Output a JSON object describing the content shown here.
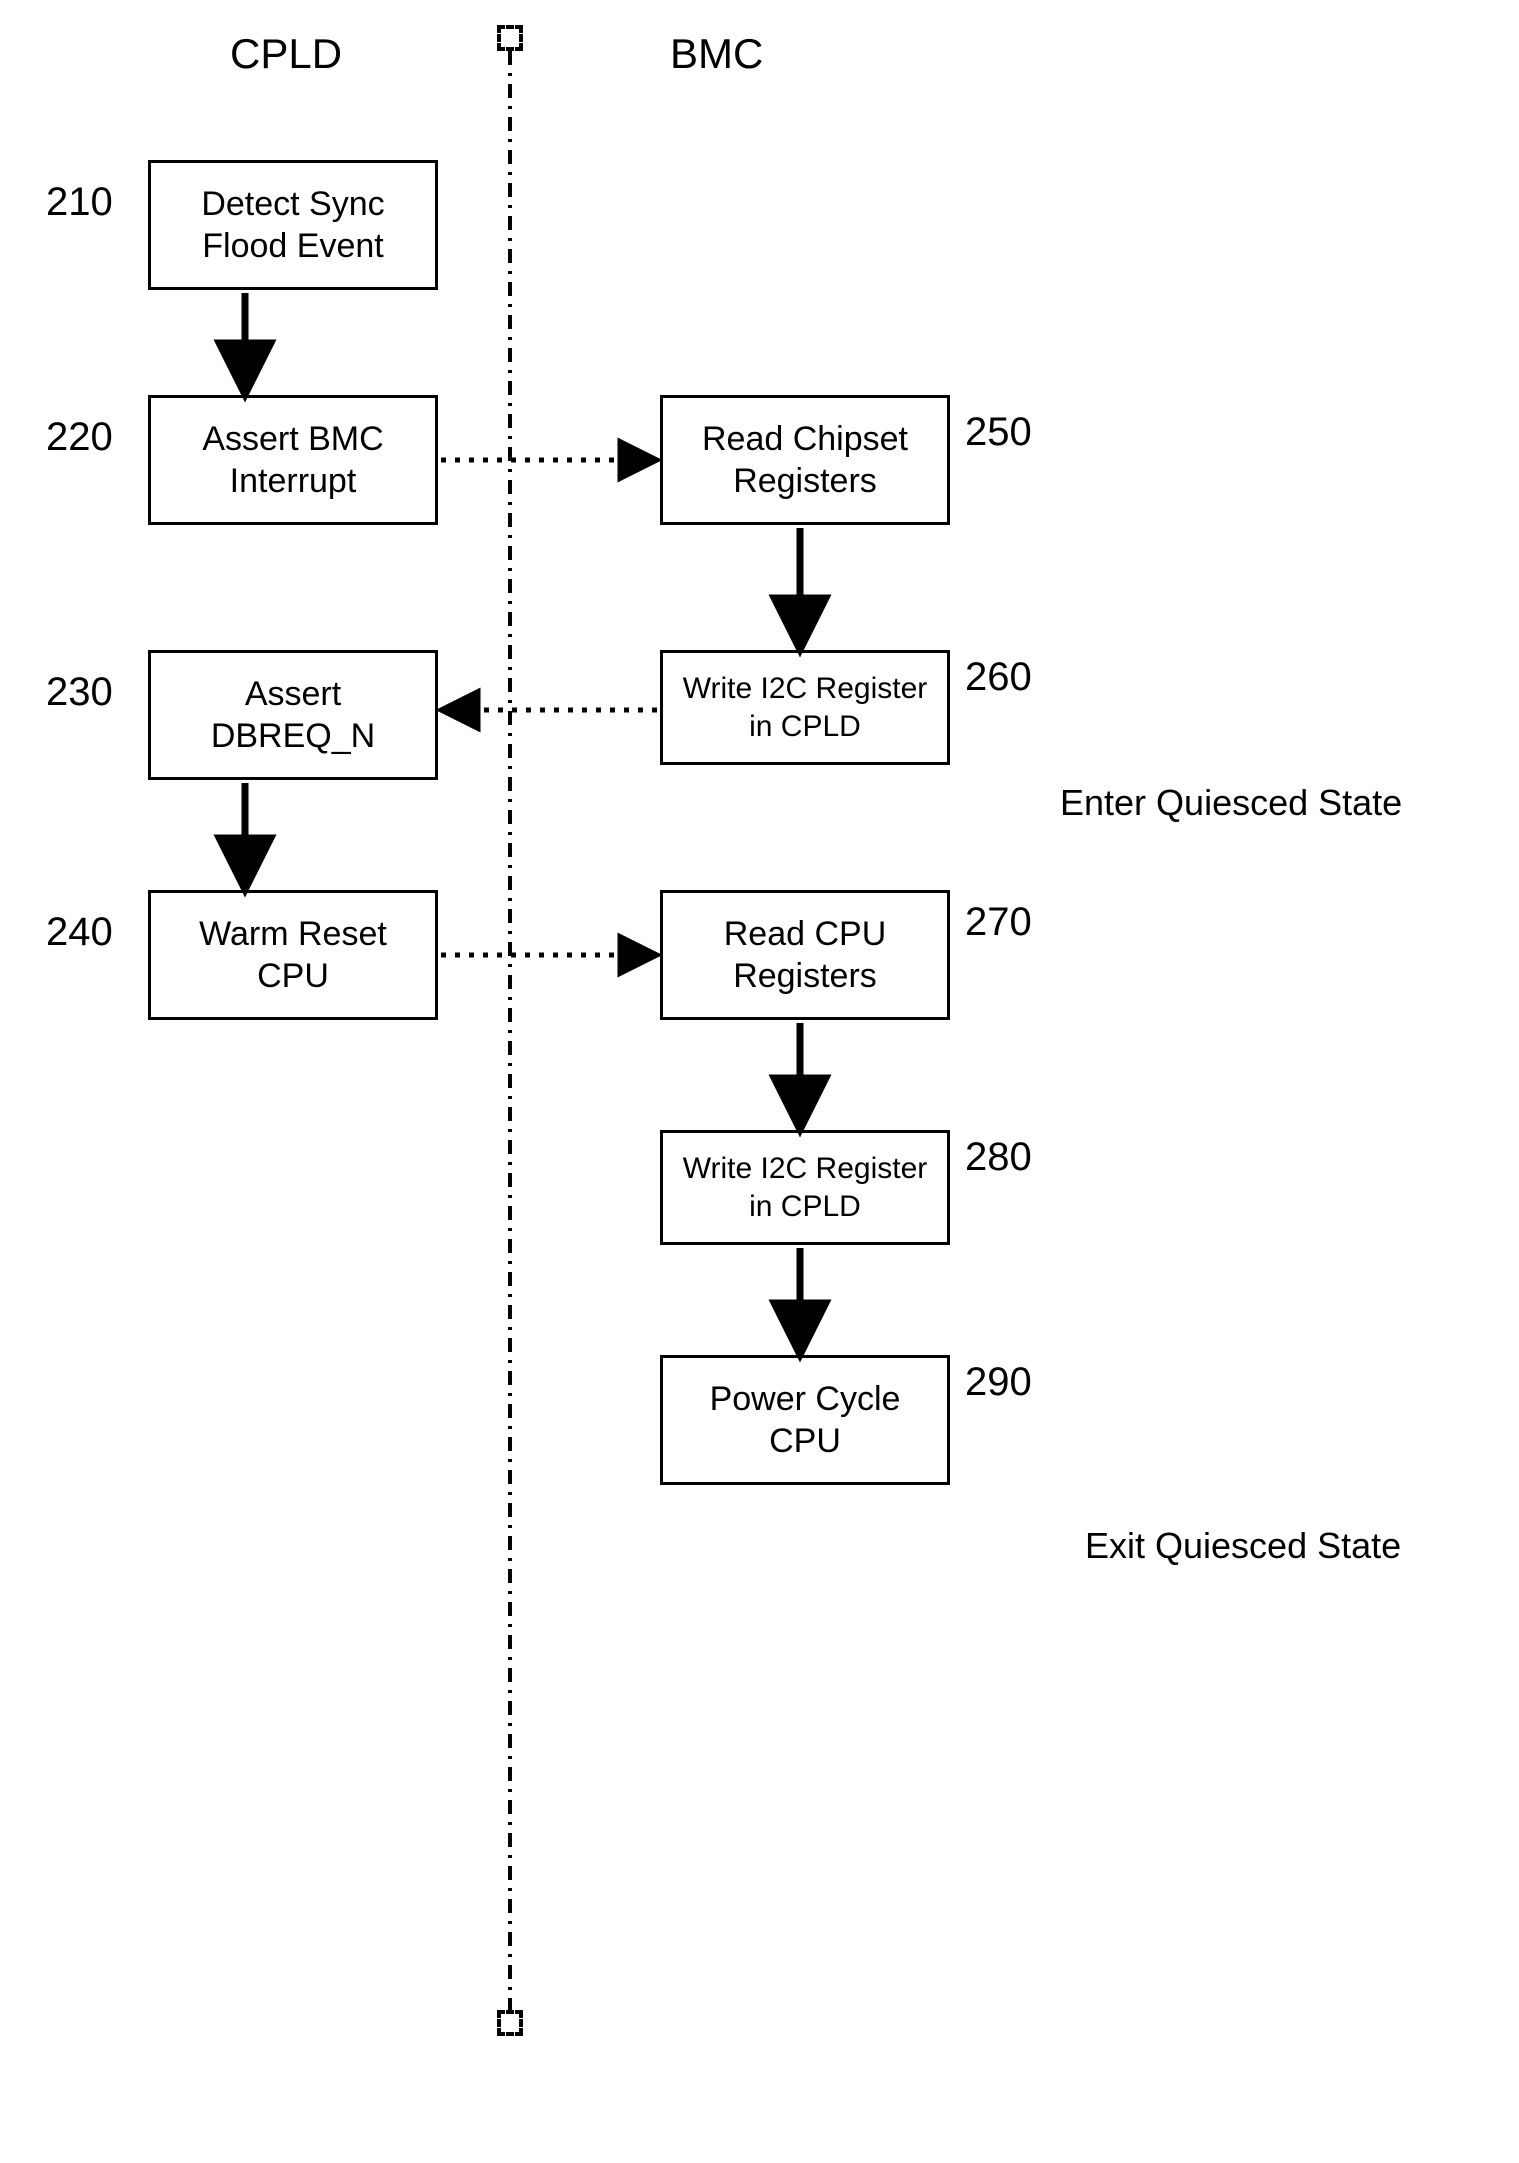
{
  "headers": {
    "cpld": "CPLD",
    "bmc": "BMC"
  },
  "boxes": {
    "b210": {
      "num": "210",
      "text": "Detect Sync\nFlood Event"
    },
    "b220": {
      "num": "220",
      "text": "Assert BMC\nInterrupt"
    },
    "b230": {
      "num": "230",
      "text": "Assert\nDBREQ_N"
    },
    "b240": {
      "num": "240",
      "text": "Warm Reset\nCPU"
    },
    "b250": {
      "num": "250",
      "text": "Read Chipset\nRegisters"
    },
    "b260": {
      "num": "260",
      "text": "Write I2C Register\nin CPLD"
    },
    "b270": {
      "num": "270",
      "text": "Read CPU\nRegisters"
    },
    "b280": {
      "num": "280",
      "text": "Write I2C Register\nin CPLD"
    },
    "b290": {
      "num": "290",
      "text": "Power Cycle\nCPU"
    }
  },
  "annotations": {
    "enter": "Enter Quiesced State",
    "exit": "Exit Quiesced State"
  }
}
